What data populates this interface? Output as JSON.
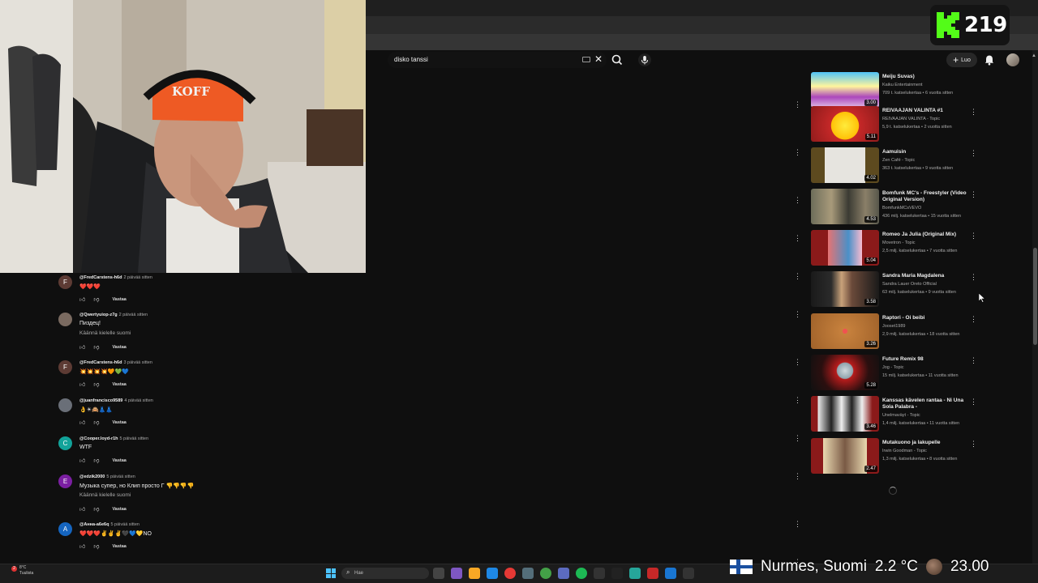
{
  "search": {
    "query": "disko tanssi"
  },
  "header": {
    "create_label": "Luo"
  },
  "overlay": {
    "kick_count": "219",
    "location": "Nurmes, Suomi",
    "temperature": "2.2 °C",
    "time": "23.00"
  },
  "recommendations": [
    {
      "title": "Meiju Suvas)",
      "channel": "Kaiku Entertainment",
      "meta": "709 t. katselukertaa • 6 vuotta sitten",
      "duration": "3.00"
    },
    {
      "title": "REIVAAJAN VALINTA #1",
      "channel": "REIVAAJAN VALINTA - Topic",
      "meta": "5,9 t. katselukertaa • 2 vuotta sitten",
      "duration": "5.11"
    },
    {
      "title": "Aamuisin",
      "channel": "Zen Café - Topic",
      "meta": "363 t. katselukertaa • 9 vuotta sitten",
      "duration": "4.02"
    },
    {
      "title": "Bomfunk MC's - Freestyler (Video Original Version)",
      "channel": "BomfunkMCsVEVO",
      "meta": "436 milj. katselukertaa • 15 vuotta sitten",
      "duration": "4.53"
    },
    {
      "title": "Romeo Ja Julia (Original Mix)",
      "channel": "Movetron - Topic",
      "meta": "2,5 milj. katselukertaa • 7 vuotta sitten",
      "duration": "5.04"
    },
    {
      "title": "Sandra Maria Magdalena",
      "channel": "Sandra Lauer Oreto Official",
      "meta": "63 milj. katselukertaa • 9 vuotta sitten",
      "duration": "3.58"
    },
    {
      "title": "Raptori - Oi beibi",
      "channel": "Jooset1989",
      "meta": "2,9 milj. katselukertaa • 18 vuotta sitten",
      "duration": "3.26"
    },
    {
      "title": "Future Remix 98",
      "channel": "Jog - Topic",
      "meta": "15 milj. katselukertaa • 11 vuotta sitten",
      "duration": "5.28"
    },
    {
      "title": "Kanssas kävelen rantaa - Ni Una Sola Palabra -",
      "channel": "Unelmaväyt - Topic",
      "meta": "1,4 milj. katselukertaa • 11 vuotta sitten",
      "duration": "3.46"
    },
    {
      "title": "Mutakuono ja lakupelle",
      "channel": "Irwin Goodman - Topic",
      "meta": "1,3 milj. katselukertaa • 8 vuotta sitten",
      "duration": "2.47"
    }
  ],
  "comments": [
    {
      "avatar_letter": "F",
      "avatar_color": "#5d3b34",
      "author": "@FredCarstens-h6d",
      "time": "2 päivää sitten",
      "text": "❤️❤️❤️",
      "reply": "Vastaa"
    },
    {
      "avatar_letter": "",
      "avatar_color": "#7a6a60",
      "author": "@Qwertyuiop-z7g",
      "time": "2 päivää sitten",
      "text": "Пиздец!",
      "translate": "Käännä kielelle suomi",
      "reply": "Vastaa"
    },
    {
      "avatar_letter": "F",
      "avatar_color": "#5d3b34",
      "author": "@FredCarstens-h6d",
      "time": "3 päivää sitten",
      "text": "💥💥💥💥🧡💚💙",
      "reply": "Vastaa"
    },
    {
      "avatar_letter": "",
      "avatar_color": "#6a6f78",
      "author": "@juanfrancisco9589",
      "time": "4 päivää sitten",
      "text": "👌☀🙈👗👗",
      "reply": "Vastaa"
    },
    {
      "avatar_letter": "C",
      "avatar_color": "#12a39a",
      "author": "@Cooper.loyd-r1h",
      "time": "5 päivää sitten",
      "text": "WTF",
      "reply": "Vastaa"
    },
    {
      "avatar_letter": "E",
      "avatar_color": "#7b1fa2",
      "author": "@edzik2000",
      "time": "5 päivää sitten",
      "text": "Музыка супер, но Клип просто Г 👎👎👎👎",
      "translate": "Käännä kielelle suomi",
      "reply": "Vastaa"
    },
    {
      "avatar_letter": "A",
      "avatar_color": "#1565c0",
      "author": "@Анна-a6e6q",
      "time": "5 päivää sitten",
      "text": "❤️❤️❤️✌️✌️✌️🖤💙💛NO",
      "reply": "Vastaa"
    }
  ],
  "taskbar": {
    "weather_temp": "8°C",
    "weather_desc": "Tuulista",
    "weather_badge": "2",
    "search_placeholder": "Hae"
  },
  "colors": {
    "youtube_bg": "#0f0f0f",
    "kick_green": "#53fc18",
    "windows_blue": "#4cc2ff"
  }
}
